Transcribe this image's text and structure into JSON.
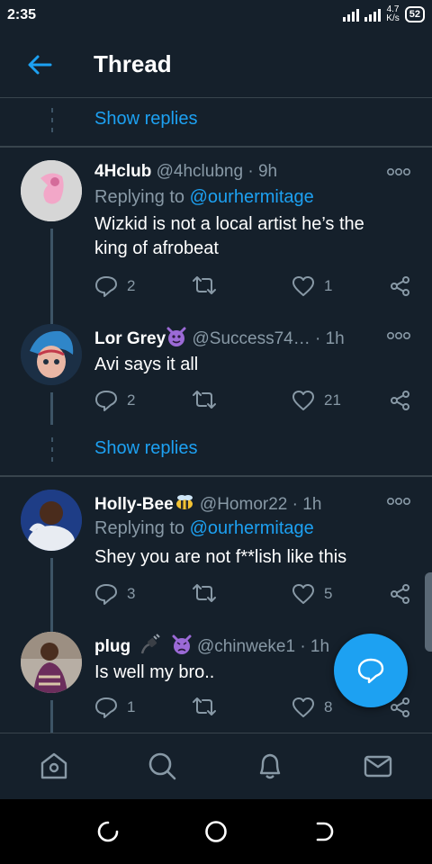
{
  "status_bar": {
    "time": "2:35",
    "net_speed_value": "4.7",
    "net_speed_unit": "K/s",
    "battery": "52"
  },
  "header": {
    "title": "Thread"
  },
  "show_replies_label": "Show replies",
  "tweets": [
    {
      "name": "4Hclub",
      "handle": "@4hclubng",
      "time": "· 9h",
      "replying_prefix": "Replying to ",
      "replying_to": "@ourhermitage",
      "text": "Wizkid is not a local artist he’s the king of afrobeat",
      "replies": "2",
      "retweets": "",
      "likes": "1"
    },
    {
      "name": "Lor Grey",
      "handle": "@Success74…",
      "time": "· 1h",
      "text": "Avi says it all",
      "replies": "2",
      "retweets": "",
      "likes": "21"
    },
    {
      "name": "Holly-Bee",
      "handle": "@Homor22",
      "time": "· 1h",
      "replying_prefix": "Replying to ",
      "replying_to": "@ourhermitage",
      "text": "Shey you are not f**lish like this",
      "replies": "3",
      "retweets": "",
      "likes": "5"
    },
    {
      "name": "plug",
      "handle": "@chinweke1",
      "time": "· 1h",
      "text": "Is well my bro..",
      "replies": "1",
      "retweets": "",
      "likes": "8"
    }
  ],
  "colors": {
    "background": "#15202b",
    "accent": "#1da1f2",
    "secondary_text": "#8899a6",
    "divider": "#38444d"
  },
  "bottom_nav": [
    "home-icon",
    "search-icon",
    "notifications-icon",
    "messages-icon"
  ]
}
